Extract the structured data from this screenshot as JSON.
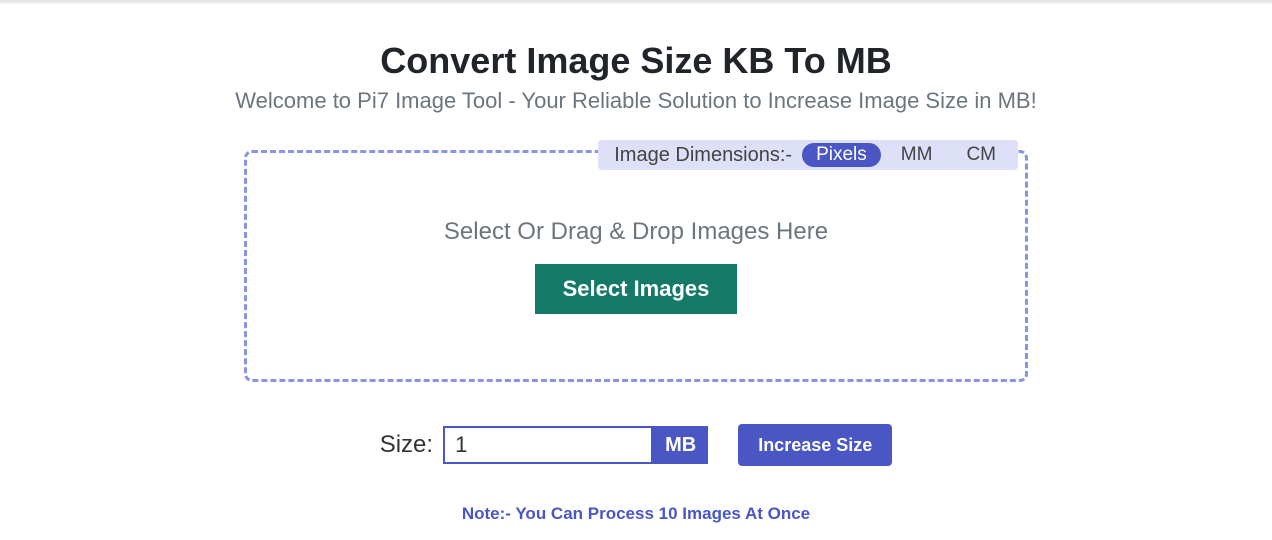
{
  "header": {
    "title": "Convert Image Size KB To MB",
    "subtitle": "Welcome to Pi7 Image Tool - Your Reliable Solution to Increase Image Size in MB!"
  },
  "dropzone": {
    "dimensions_label": "Image Dimensions:-",
    "units": {
      "pixels": "Pixels",
      "mm": "MM",
      "cm": "CM"
    },
    "drop_text": "Select Or Drag & Drop Images Here",
    "select_button": "Select Images"
  },
  "controls": {
    "size_label": "Size:",
    "size_value": "1",
    "unit": "MB",
    "increase_button": "Increase Size"
  },
  "note": "Note:- You Can Process 10 Images At Once"
}
